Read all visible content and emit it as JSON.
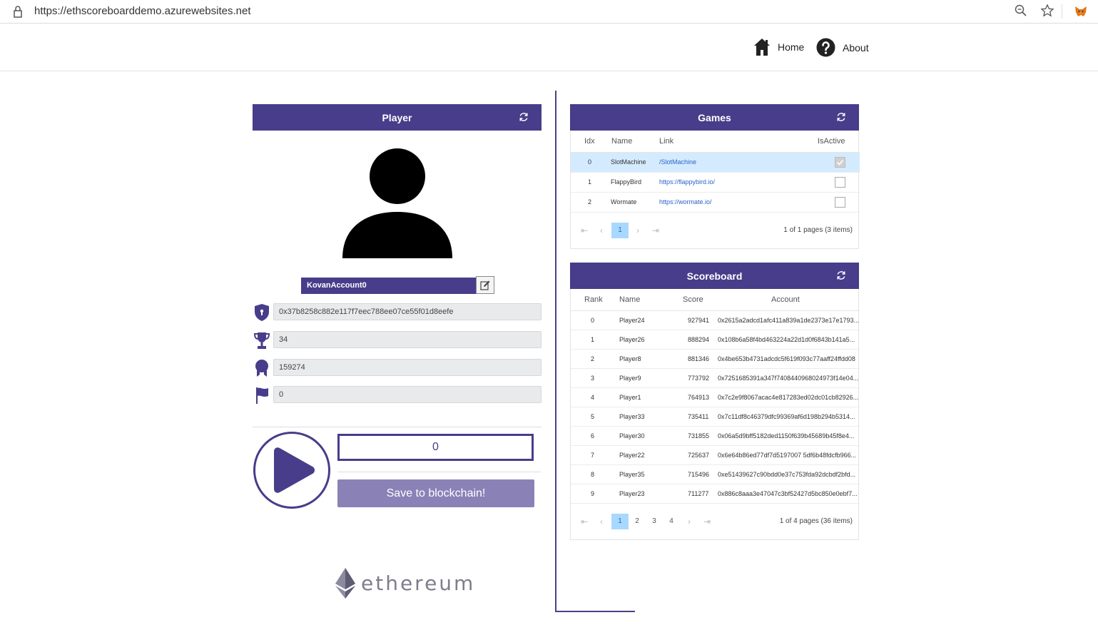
{
  "browser": {
    "url": "https://ethscoreboarddemo.azurewebsites.net",
    "icons": [
      "lock-icon",
      "zoom-icon",
      "star-icon",
      "metamask-fox-icon"
    ]
  },
  "nav": {
    "home_label": "Home",
    "about_label": "About"
  },
  "player": {
    "title": "Player",
    "account_name": "KovanAccount0",
    "address": "0x37b8258c882e117f7eec788ee07ce55f01d8eefe",
    "trophies": "34",
    "score": "159274",
    "flags": "0",
    "current_score": "0",
    "save_label": "Save to blockchain!"
  },
  "games": {
    "title": "Games",
    "columns": [
      "Idx",
      "Name",
      "Link",
      "IsActive"
    ],
    "rows": [
      {
        "idx": "0",
        "name": "SlotMachine",
        "link": "/SlotMachine",
        "active": true
      },
      {
        "idx": "1",
        "name": "FlappyBird",
        "link": "https://flappybird.io/",
        "active": false
      },
      {
        "idx": "2",
        "name": "Wormate",
        "link": "https://wormate.io/",
        "active": false
      }
    ],
    "pages": [
      "1"
    ],
    "page_info": "1 of 1 pages (3 items)"
  },
  "scoreboard": {
    "title": "Scoreboard",
    "columns": [
      "Rank",
      "Name",
      "Score",
      "Account"
    ],
    "rows": [
      {
        "rank": "0",
        "name": "Player24",
        "score": "927941",
        "account": "0x2615a2adcd1afc411a839a1de2373e17e1793..."
      },
      {
        "rank": "1",
        "name": "Player26",
        "score": "888294",
        "account": "0x108b6a58f4bd463224a22d1d0f6843b141a5..."
      },
      {
        "rank": "2",
        "name": "Player8",
        "score": "881346",
        "account": "0x4be653b4731adcdc5f619f093c77aaff24ffdd08"
      },
      {
        "rank": "3",
        "name": "Player9",
        "score": "773792",
        "account": "0x7251685391a347f7408440968024973f14e04..."
      },
      {
        "rank": "4",
        "name": "Player1",
        "score": "764913",
        "account": "0x7c2e9f8067acac4e817283ed02dc01cb82926..."
      },
      {
        "rank": "5",
        "name": "Player33",
        "score": "735411",
        "account": "0x7c11df8c46379dfc99369af6d198b294b5314..."
      },
      {
        "rank": "6",
        "name": "Player30",
        "score": "731855",
        "account": "0x06a5d9bff5182ded1150f639b45689b45f8e4..."
      },
      {
        "rank": "7",
        "name": "Player22",
        "score": "725637",
        "account": "0x6e64b86ed77df7d5197007 5df6b48fdcfb966..."
      },
      {
        "rank": "8",
        "name": "Player35",
        "score": "715496",
        "account": "0xe51439627c90bdd0e37c753fda92dcbdf2bfd..."
      },
      {
        "rank": "9",
        "name": "Player23",
        "score": "711277",
        "account": "0x886c8aaa3e47047c3bf52427d5bc850e0ebf7..."
      }
    ],
    "pages": [
      "1",
      "2",
      "3",
      "4"
    ],
    "page_info": "1 of 4 pages (36 items)"
  },
  "footer": {
    "logo_text": "ethereum"
  },
  "colors": {
    "primary": "#473d8a",
    "primary_light": "#8a82b7",
    "selected_row": "#d4ebff",
    "active_page": "#a9d8ff"
  }
}
